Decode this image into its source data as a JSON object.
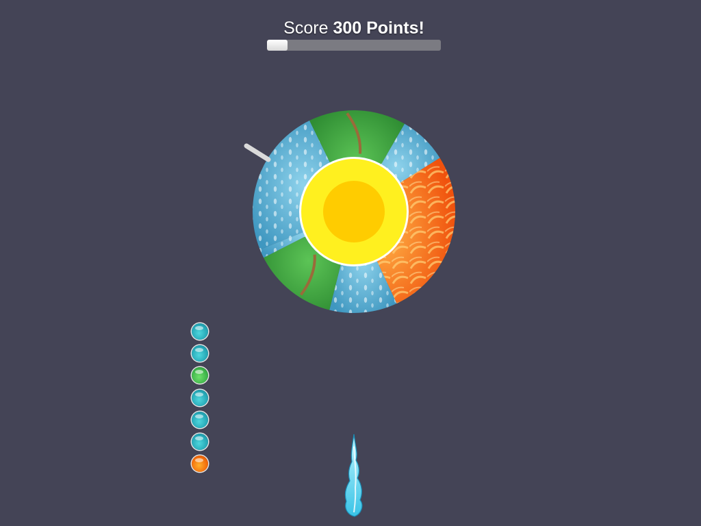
{
  "hud": {
    "score_prefix": "Score",
    "score_value": "300 Points!",
    "progress_fraction": 0.12
  },
  "wheel": {
    "segments": [
      "water",
      "grass",
      "water",
      "fire",
      "water",
      "grass",
      "water"
    ],
    "center": "sun"
  },
  "queue": {
    "balls": [
      "water",
      "water",
      "grass",
      "water",
      "water",
      "water",
      "fire"
    ]
  },
  "projectile": {
    "element": "water",
    "icon": "water-flame-icon"
  },
  "colors": {
    "background": "#444456",
    "water": "#5aaed0",
    "grass": "#3fa341",
    "fire": "#f56a1e",
    "sun": "#fff01f",
    "sun_core": "#ffcc00"
  }
}
